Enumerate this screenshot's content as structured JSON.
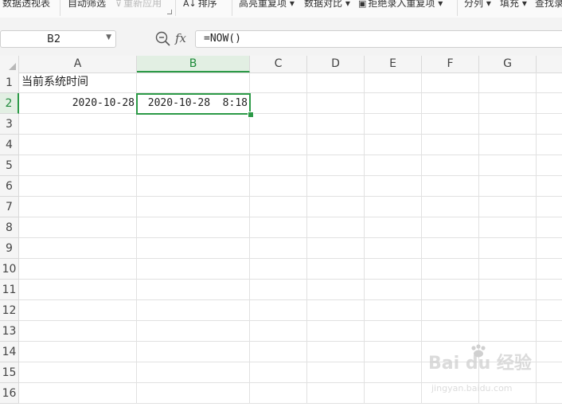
{
  "toolbar": {
    "items": [
      "数据透视表",
      "自动筛选",
      "重新应用",
      "排序",
      "高亮重复项",
      "数据对比",
      "拒绝录入重复项",
      "分列",
      "填充",
      "查找录"
    ],
    "sort_icon": "A↓"
  },
  "formula_bar": {
    "name_box": "B2",
    "fx_label": "fx",
    "formula": "=NOW()"
  },
  "columns": [
    "A",
    "B",
    "C",
    "D",
    "E",
    "F",
    "G"
  ],
  "rows": [
    "1",
    "2",
    "3",
    "4",
    "5",
    "6",
    "7",
    "8",
    "9",
    "10",
    "11",
    "12",
    "13",
    "14",
    "15",
    "16"
  ],
  "cells": {
    "A1": "当前系统时间",
    "A2": "2020-10-28",
    "B2": "2020-10-28  8:18"
  },
  "selected_cell": "B2",
  "colors": {
    "accent": "#2c9a47",
    "header_bg": "#f5f5f5",
    "grid": "#e1e1e1"
  },
  "watermark": {
    "main": "Bai du 经验",
    "sub": "jingyan.baidu.com"
  }
}
